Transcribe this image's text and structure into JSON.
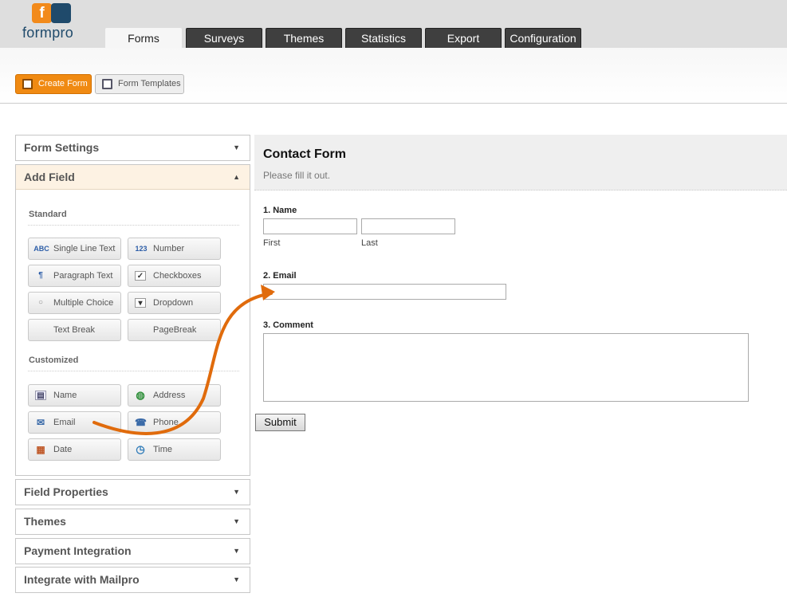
{
  "app": {
    "logo_letter": "f",
    "logo_text": "formpro"
  },
  "tabs": [
    "Forms",
    "Surveys",
    "Themes",
    "Statistics",
    "Export",
    "Configuration"
  ],
  "toolbar": {
    "create": "Create Form",
    "templates": "Form Templates"
  },
  "panels": {
    "form_settings": "Form Settings",
    "add_field": "Add Field",
    "field_properties": "Field Properties",
    "themes": "Themes",
    "payment": "Payment Integration",
    "mailpro": "Integrate with Mailpro"
  },
  "sections": {
    "standard": "Standard",
    "customized": "Customized"
  },
  "standard_fields": [
    {
      "label": "Single Line Text",
      "icon": "abc-icon",
      "glyph": "ABC"
    },
    {
      "label": "Number",
      "icon": "number-icon",
      "glyph": "123"
    },
    {
      "label": "Paragraph Text",
      "icon": "paragraph-icon",
      "glyph": "¶"
    },
    {
      "label": "Checkboxes",
      "icon": "checkbox-icon",
      "glyph": "✓"
    },
    {
      "label": "Multiple Choice",
      "icon": "radio-icon",
      "glyph": "○"
    },
    {
      "label": "Dropdown",
      "icon": "dropdown-icon",
      "glyph": "▾"
    },
    {
      "label": "Text Break",
      "icon": "",
      "glyph": ""
    },
    {
      "label": "PageBreak",
      "icon": "",
      "glyph": ""
    }
  ],
  "custom_fields": [
    {
      "label": "Name",
      "icon": "name-card-icon",
      "glyph": "▤"
    },
    {
      "label": "Address",
      "icon": "globe-icon",
      "glyph": "◍"
    },
    {
      "label": "Email",
      "icon": "envelope-icon",
      "glyph": "✉"
    },
    {
      "label": "Phone",
      "icon": "phone-icon",
      "glyph": "☎"
    },
    {
      "label": "Date",
      "icon": "calendar-icon",
      "glyph": "▦"
    },
    {
      "label": "Time",
      "icon": "clock-icon",
      "glyph": "◷"
    }
  ],
  "form": {
    "title": "Contact Form",
    "description": "Please fill it out.",
    "q1": "1. Name",
    "q1_first": "First",
    "q1_last": "Last",
    "q2": "2. Email",
    "q3": "3. Comment",
    "submit": "Submit"
  },
  "colors": {
    "accent": "#f08a12",
    "brand_dark": "#1f4a6b",
    "arrow": "#e06b0c"
  }
}
